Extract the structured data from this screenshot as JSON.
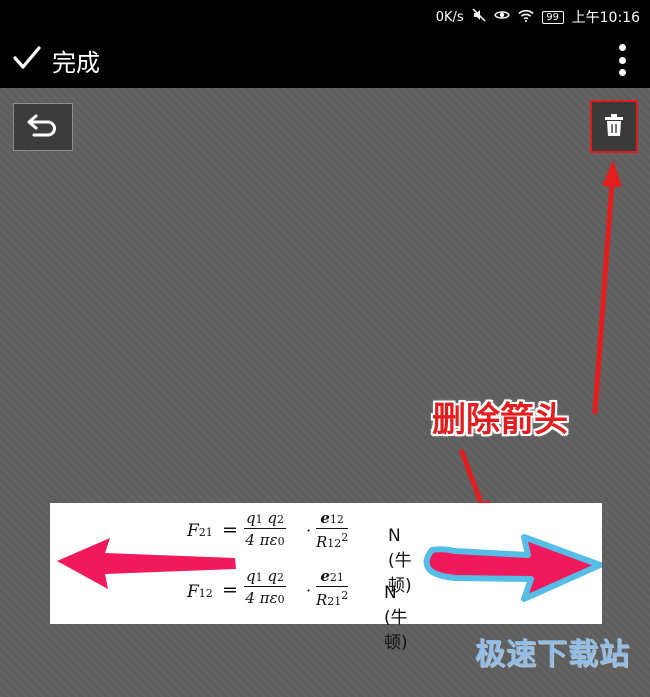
{
  "status_bar": {
    "network_speed": "0K/s",
    "battery_level": "99",
    "time": "上午10:16",
    "icons": [
      "mute-icon",
      "eye-icon",
      "wifi-icon",
      "battery-icon"
    ]
  },
  "toolbar": {
    "done_label": "完成",
    "done_icon": "checkmark-icon",
    "more_icon": "more-vertical-icon"
  },
  "editor": {
    "undo_icon": "undo-icon",
    "delete_icon": "trash-icon",
    "delete_highlight_color": "#e21b1b"
  },
  "annotation": {
    "label": "删除箭头",
    "color": "#e41e1e"
  },
  "image": {
    "formula1": {
      "lhs": "F",
      "lhs_sub": "21",
      "num1": "q",
      "num1_sub": "1",
      "num2": "q",
      "num2_sub": "2",
      "den": "4 πε",
      "den_sub": "0",
      "vec": "e",
      "vec_sub": "12",
      "r": "R",
      "r_sub": "12",
      "r_sup": "2",
      "unit": "N (牛顿)"
    },
    "formula2": {
      "lhs": "F",
      "lhs_sub": "12",
      "num1": "q",
      "num1_sub": "1",
      "num2": "q",
      "num2_sub": "2",
      "den": "4 πε",
      "den_sub": "0",
      "vec": "e",
      "vec_sub": "21",
      "r": "R",
      "r_sub": "21",
      "r_sup": "2",
      "unit": "N (牛顿)"
    },
    "left_arrow_color": "#f0195c",
    "right_arrow_fill": "#f0195c",
    "right_arrow_outline": "#55bde6"
  },
  "watermark": "极速下载站"
}
